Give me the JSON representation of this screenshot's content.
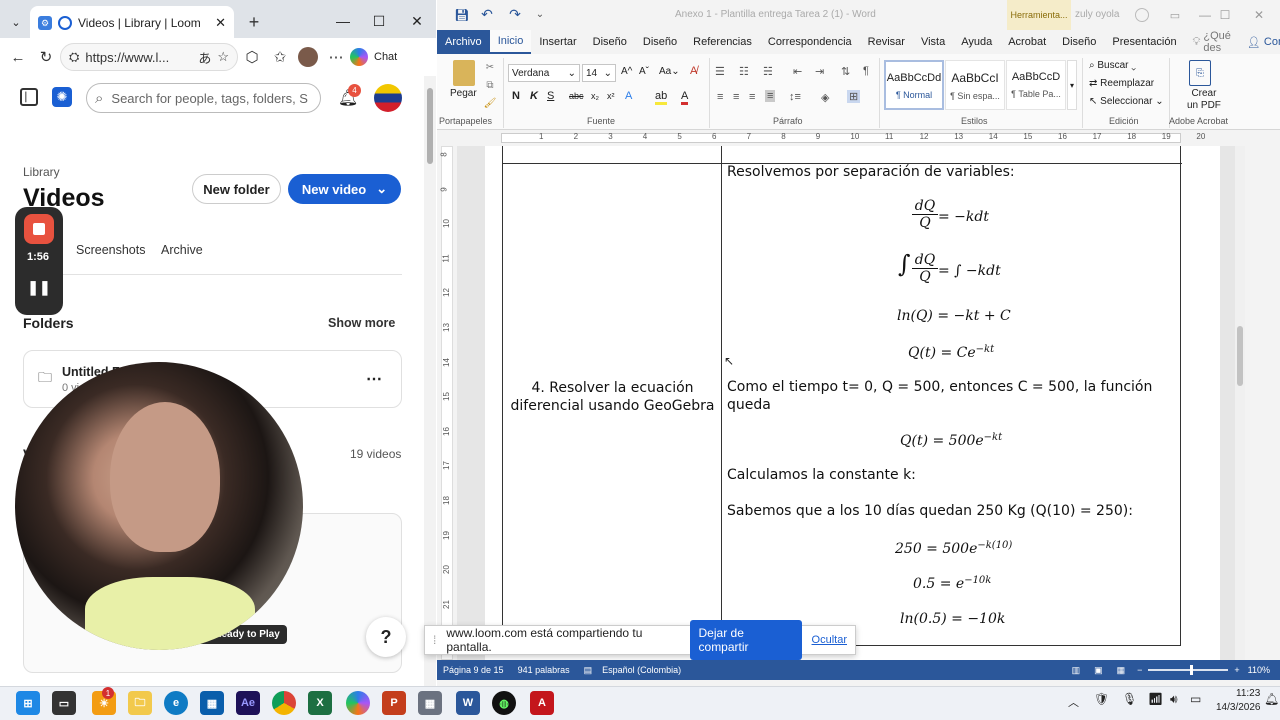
{
  "browser": {
    "tab_title": "Videos | Library | Loom",
    "url": "https://www.l...",
    "chat_label": "Chat",
    "new_tab_symbol": "+"
  },
  "loom": {
    "search_placeholder": "Search for people, tags, folders, S",
    "notification_count": "4",
    "library_label": "Library",
    "page_title": "Videos",
    "new_folder_label": "New folder",
    "new_video_label": "New video",
    "tabs": [
      "Screenshots",
      "Archive"
    ],
    "folders_heading": "Folders",
    "show_more_label": "Show more",
    "folder_name": "Untitled Fo",
    "folder_meta": "0 vi",
    "videos_count": "19 videos",
    "video_heading_partial": "V",
    "ready_label": "g... Ready to Play",
    "help_label": "?",
    "recording_timer": "1:56"
  },
  "word": {
    "title": "Anexo 1 - Plantilla entrega Tarea 2 (1)  -  Word",
    "tools_label": "Herramienta...",
    "user_name": "zuly oyola",
    "tabs": [
      "Archivo",
      "Inicio",
      "Insertar",
      "Diseño",
      "Diseño",
      "Referencias",
      "Correspondencia",
      "Revisar",
      "Vista",
      "Ayuda",
      "Acrobat",
      "Diseño",
      "Presentación"
    ],
    "tell_me": "¿Qué des",
    "share_label": "Compartir",
    "ribbon": {
      "paste_label": "Pegar",
      "font_name": "Verdana",
      "font_size": "14",
      "styles": [
        "AaBbCcDd",
        "AaBbCcI",
        "AaBbCcD"
      ],
      "style_names": [
        "¶ Normal",
        "¶ Sin espa...",
        "¶ Table Pa..."
      ],
      "find_label": "Buscar",
      "replace_label": "Reemplazar",
      "select_label": "Seleccionar",
      "create_pdf_line1": "Crear",
      "create_pdf_line2": "un PDF",
      "groups": [
        "Portapapeles",
        "Fuente",
        "Párrafo",
        "Estilos",
        "Edición",
        "Adobe Acrobat"
      ]
    },
    "ruler_numbers": [
      "1",
      "2",
      "3",
      "4",
      "5",
      "6",
      "7",
      "8",
      "9",
      "10",
      "11",
      "12",
      "13",
      "14",
      "15",
      "16",
      "17",
      "18",
      "19",
      "20"
    ],
    "vruler_numbers": [
      "8",
      "9",
      "10",
      "11",
      "12",
      "13",
      "14",
      "15",
      "16",
      "17",
      "18",
      "19",
      "20",
      "21"
    ],
    "document": {
      "left_cell": "4. Resolver la ecuación diferencial usando GeoGebra",
      "line1": "Resolvemos por separación de variables:",
      "eq1_num": "dQ",
      "eq1_den": "Q",
      "eq1_rhs": "= −kdt",
      "eq2_rhs": "= ∫ −kdt",
      "eq3": "ln(Q) = −kt + C",
      "eq4": "Q(t) = Ce",
      "eq4_exp": "−kt",
      "line2": "Como el tiempo t= 0, Q = 500, entonces C = 500, la función queda",
      "eq5": "Q(t) = 500e",
      "eq5_exp": "−kt",
      "line3": "Calculamos la constante k:",
      "line4": "Sabemos que a los 10 días quedan 250 Kg (Q(10) = 250):",
      "eq6": "250 = 500e",
      "eq6_exp": "−k(10)",
      "eq7": "0.5 = e",
      "eq7_exp": "−10k",
      "eq8": "ln(0.5) = −10k"
    },
    "status": {
      "page": "Página 9 de 15",
      "words": "941 palabras",
      "language": "Español (Colombia)",
      "zoom": "110%"
    }
  },
  "share_bar": {
    "message": "www.loom.com está compartiendo tu pantalla.",
    "stop_label": "Dejar de compartir",
    "hide_label": "Ocultar"
  },
  "taskbar": {
    "time": "11:23",
    "date": "14/3/2026",
    "badge": "1"
  },
  "colors": {
    "word_blue": "#2b579a",
    "loom_blue": "#1a5fd3",
    "record_red": "#e8523f"
  }
}
